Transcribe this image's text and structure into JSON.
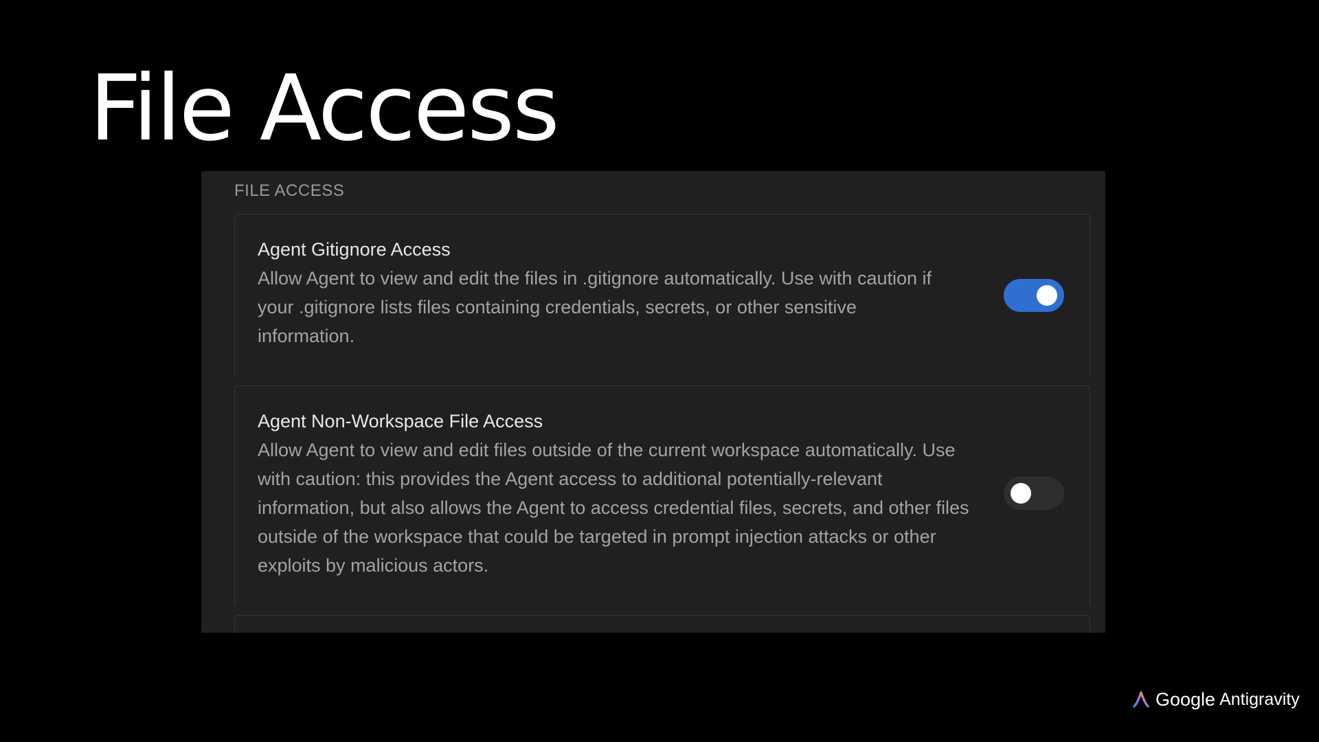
{
  "slide": {
    "title": "File Access"
  },
  "panel": {
    "section_label": "FILE ACCESS",
    "settings": [
      {
        "title": "Agent Gitignore Access",
        "description": "Allow Agent to view and edit the files in .gitignore automatically. Use with caution if your .gitignore lists files containing credentials, secrets, or other sensitive information.",
        "enabled": true
      },
      {
        "title": "Agent Non-Workspace File Access",
        "description": "Allow Agent to view and edit files outside of the current workspace automatically. Use with caution: this provides the Agent access to additional potentially-relevant information, but also allows the Agent to access credential files, secrets, and other files outside of the workspace that could be targeted in prompt injection attacks or other exploits by malicious actors.",
        "enabled": false
      }
    ]
  },
  "branding": {
    "google": "Google",
    "product": "Antigravity",
    "icon": "antigravity-logo-icon"
  },
  "colors": {
    "background": "#000000",
    "panel": "#202020",
    "toggle_on": "#2f6fd0",
    "toggle_off": "#2e2e2e"
  }
}
